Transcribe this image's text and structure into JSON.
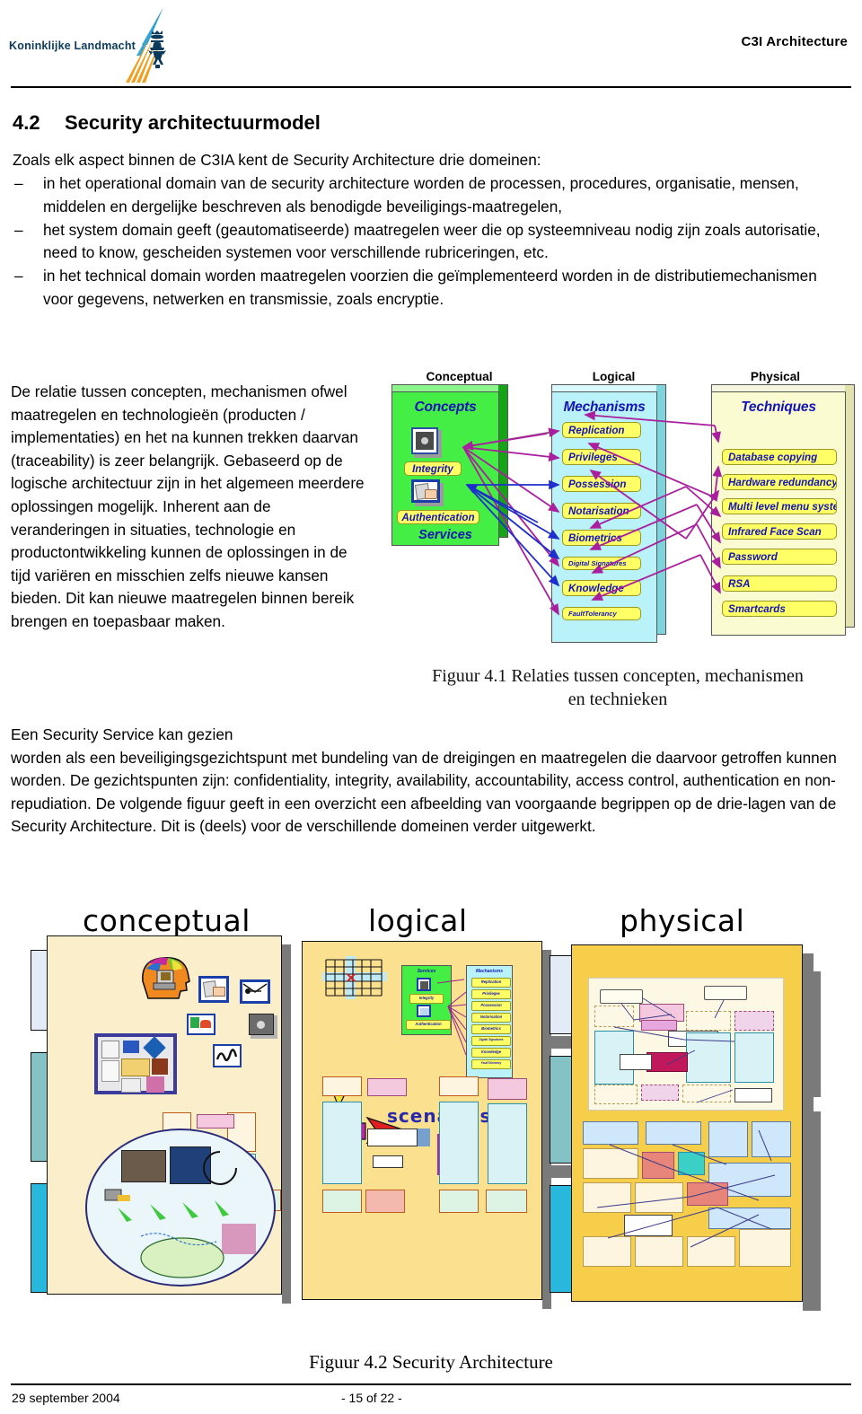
{
  "header": {
    "logo_text": "Koninklijke Landmacht",
    "logo_icon": "kl-swoosh-lion-logo",
    "doc_title": "C3I Architecture"
  },
  "section": {
    "number": "4.2",
    "title": "Security architectuurmodel",
    "intro": "Zoals elk aspect binnen de C3IA kent de Security Architecture drie domeinen:",
    "dash": "–",
    "bullets": [
      "in het operational domain van de security architecture worden de processen, procedures, organisatie, mensen, middelen en dergelijke beschreven als benodigde beveiligings-maatregelen,",
      "het system domain geeft (geautomatiseerde) maatregelen weer die op systeemniveau nodig zijn zoals autorisatie, need to know, gescheiden systemen voor verschillende rubriceringen, etc.",
      "in het technical domain worden maatregelen voorzien die geïmplementeerd worden in de distributiemechanismen voor gegevens, netwerken en transmissie, zoals encryptie."
    ]
  },
  "left_column_paragraph": "De relatie tussen concepten, mechanismen ofwel maatregelen en technologieën (producten / implementaties) en het na kunnen trekken daarvan (traceability) is zeer belangrijk. Gebaseerd op de logische architectuur zijn in het algemeen meerdere oplossingen mogelijk. Inherent aan de veranderingen in situaties, technologie en productontwikkeling kunnen de oplossingen in de tijd variëren en misschien zelfs nieuwe kansen bieden. Dit kan nieuwe maatregelen binnen bereik brengen en toepasbaar maken.",
  "tail_paragraph_lines": [
    "Een Security Service kan gezien",
    "worden als een beveiligingsgezichtspunt met bundeling van de dreigingen en maatregelen die daarvoor getroffen kunnen worden. De gezichtspunten zijn: confidentiality, integrity, availability, accountability, access control, authentication en non-repudiation.",
    "De volgende figuur geeft in een overzicht een afbeelding van voorgaande begrippen op de drie-lagen van de Security Architecture. Dit is (deels) voor de verschillende domeinen verder uitgewerkt."
  ],
  "figure41": {
    "caption_line1": "Figuur  4.1 Relaties tussen concepten, mechanismen",
    "caption_line2": "en technieken",
    "column_labels": [
      "Conceptual",
      "Logical",
      "Physical"
    ],
    "conceptual": {
      "title": "Concepts",
      "services_label": "Services",
      "items": [
        "Integrity",
        "Authentication"
      ],
      "icons": [
        "safe-vault-icon",
        "signature-hand-icon"
      ],
      "color": "#44ee44"
    },
    "logical": {
      "title": "Mechanisms",
      "items": [
        "Replication",
        "Privileges",
        "Possession",
        "Notarisation",
        "Biometrics",
        "Digital Signatures",
        "Knowledge",
        "FaultTolerancy"
      ],
      "color": "#b9f2f8"
    },
    "physical": {
      "title": "Techniques",
      "items": [
        "Database copying",
        "Hardware redundancy",
        "Multi level menu system",
        "Infrared Face Scan",
        "Password",
        "RSA",
        "Smartcards"
      ],
      "color": "#fbfbd2"
    },
    "arrow_colors": {
      "magenta": "#aa1f9e",
      "blue": "#1f2fcc",
      "plum": "#8a4a7a"
    }
  },
  "figure42": {
    "caption": "Figuur  4.2  Security Architecture",
    "headings": [
      "conceptual",
      "logical",
      "physical"
    ],
    "scenarios_label": "scenarios",
    "mini_services": {
      "title": "Services",
      "items": [
        "Integrity",
        "Authentication"
      ]
    },
    "mini_mechanisms": {
      "title": "Mechanisms",
      "items": [
        "Replication",
        "Privileges",
        "Possession",
        "Notarisation",
        "Biometrics",
        "Digital Signatures",
        "Knowledge",
        "FaultTolerancy"
      ]
    },
    "panel_colors": {
      "conceptual": "#fbeecb",
      "logical": "#fae08f",
      "physical": "#f7ce4a"
    }
  },
  "footer": {
    "date": "29 september 2004",
    "page": "-  15  of 22 -"
  }
}
